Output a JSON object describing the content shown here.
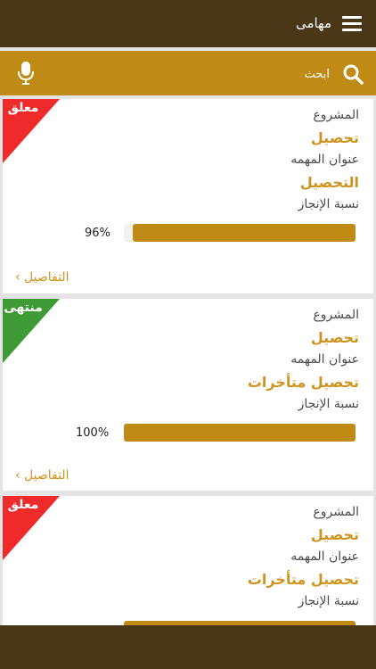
{
  "header": {
    "title": "مهامى",
    "menu_icon": "hamburger-menu-icon"
  },
  "search": {
    "placeholder": "ابحث",
    "search_icon": "search-icon",
    "mic_icon": "microphone-icon"
  },
  "colors": {
    "topbar": "#4a3718",
    "accent": "#c08b14",
    "value_text": "#d09320",
    "status_suspended": "#ee2a2a",
    "status_finished": "#3d9a34"
  },
  "tasks": [
    {
      "status": "معلق",
      "status_color": "#ee2a2a",
      "project_label": "المشروع",
      "project": "تحصيل",
      "title_label": "عنوان المهمه",
      "title": "التحصيل",
      "progress_label": "نسبة الإنجاز",
      "progress": 96,
      "progress_text": "96%",
      "details": "التفاصيل ›"
    },
    {
      "status": "منتهى",
      "status_color": "#3d9a34",
      "project_label": "المشروع",
      "project": "تحصيل",
      "title_label": "عنوان المهمه",
      "title": "تحصيل متأخرات",
      "progress_label": "نسبة الإنجاز",
      "progress": 100,
      "progress_text": "100%",
      "details": "التفاصيل ›"
    },
    {
      "status": "معلق",
      "status_color": "#ee2a2a",
      "project_label": "المشروع",
      "project": "تحصيل",
      "title_label": "عنوان المهمه",
      "title": "تحصيل متأخرات",
      "progress_label": "نسبة الإنجاز"
    }
  ]
}
